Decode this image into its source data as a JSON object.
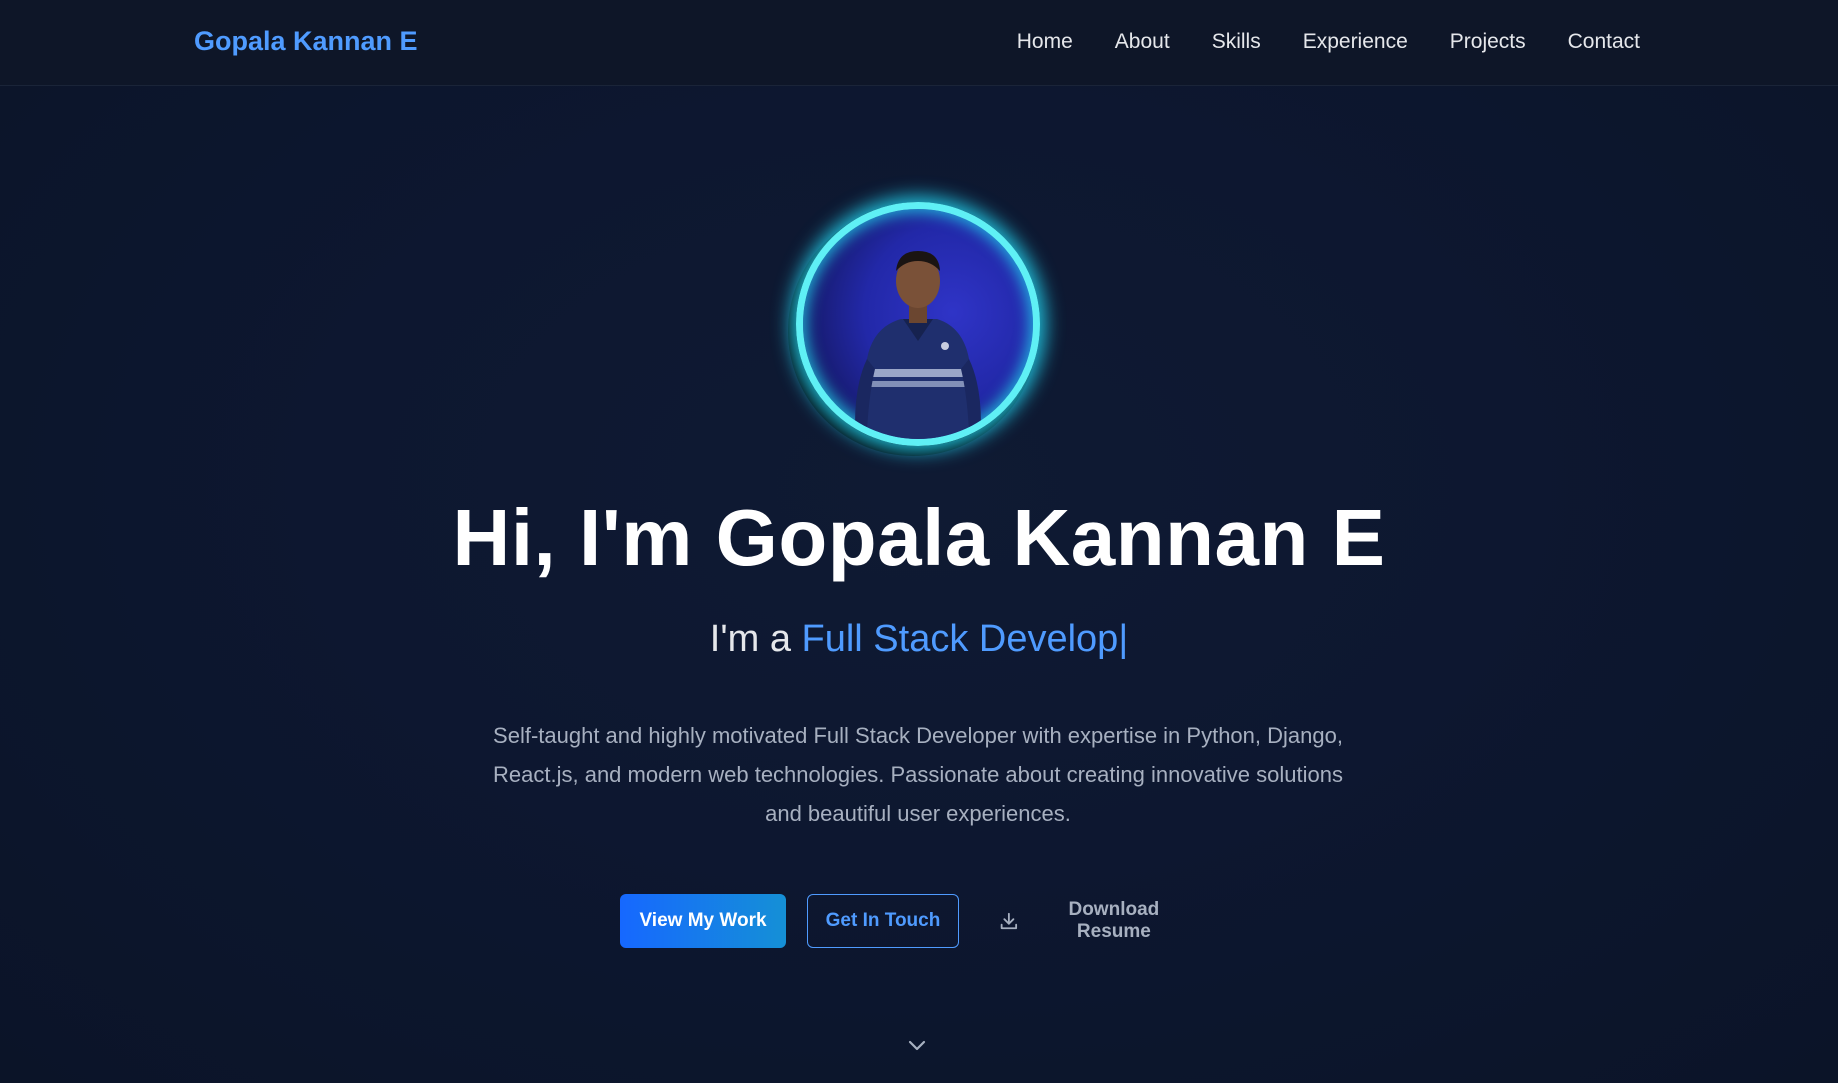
{
  "nav": {
    "brand": "Gopala Kannan E",
    "links": [
      "Home",
      "About",
      "Skills",
      "Experience",
      "Projects",
      "Contact"
    ]
  },
  "hero": {
    "avatar_alt": "Profile photo of Gopala Kannan E",
    "heading": "Hi, I'm Gopala Kannan E",
    "role_prefix": "I'm a ",
    "role_typed": "Full Stack Develop",
    "role_caret": "|",
    "bio": "Self-taught and highly motivated Full Stack Developer with expertise in Python, Django, React.js, and modern web technologies. Passionate about creating innovative solutions and beautiful user experiences.",
    "buttons": {
      "primary": "View My Work",
      "secondary": "Get In Touch",
      "tertiary": "Download Resume"
    },
    "scroll_icon": "chevron-down-icon"
  },
  "colors": {
    "accent": "#4f9bff",
    "glow": "#22d3ee",
    "background": "#0d1730"
  }
}
